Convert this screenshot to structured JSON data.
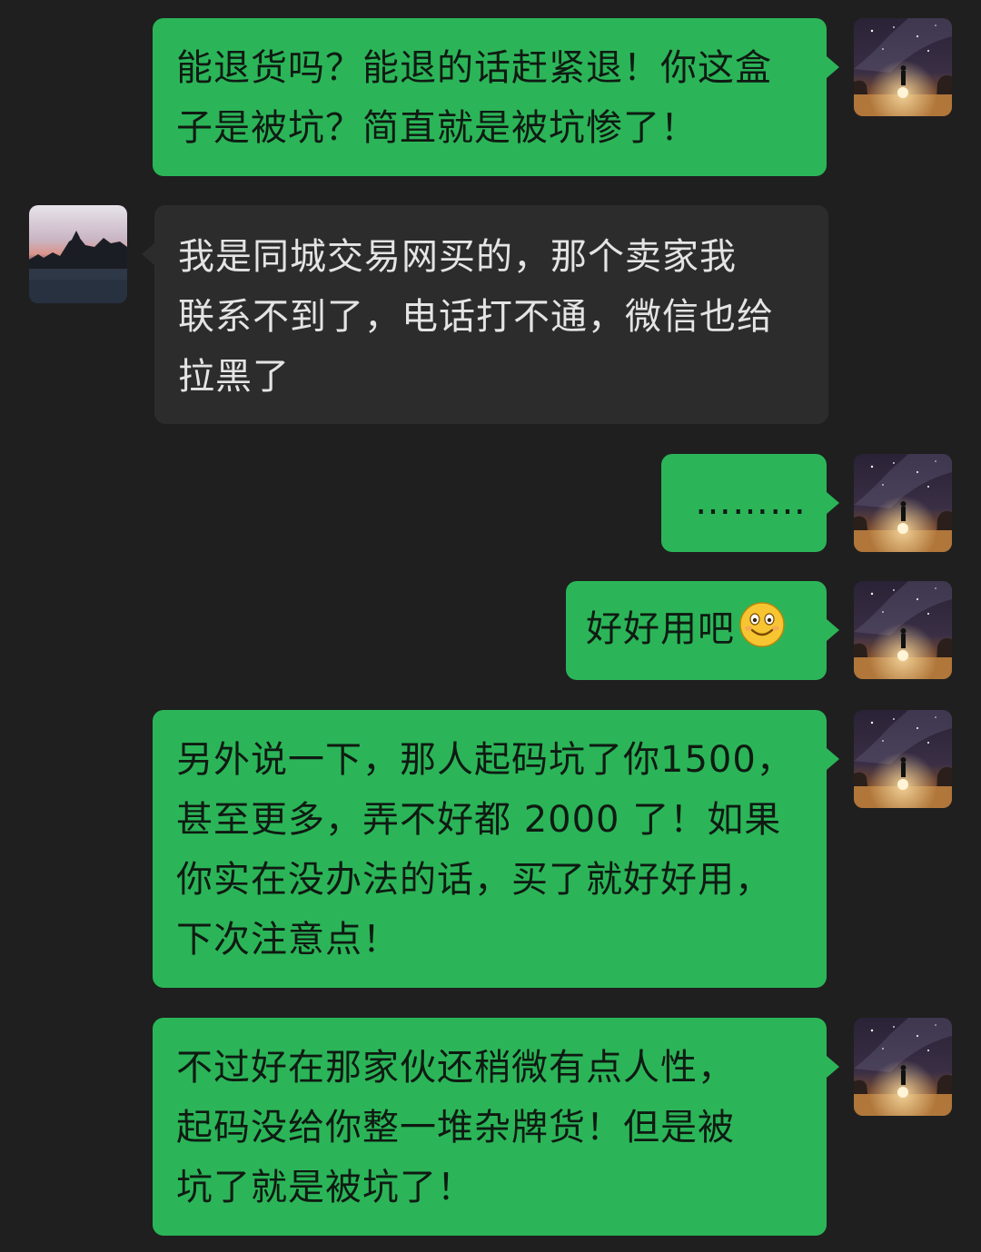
{
  "conversation": {
    "messages": [
      {
        "side": "out",
        "lines": [
          "能退货吗？能退的话赶紧退！你这盒",
          "子是被坑？简直就是被坑惨了！"
        ]
      },
      {
        "side": "in",
        "lines": [
          "我是同城交易网买的，那个卖家我",
          "联系不到了，电话打不通，微信也给",
          "拉黑了"
        ]
      },
      {
        "side": "out",
        "lines": [
          "………"
        ]
      },
      {
        "side": "out",
        "lines": [
          "好好用吧"
        ],
        "emoji": "smile-emoji"
      },
      {
        "side": "out",
        "lines": [
          "另外说一下，那人起码坑了你1500，",
          "甚至更多，弄不好都 2000 了！如果",
          "你实在没办法的话，买了就好好用，",
          "下次注意点！"
        ]
      },
      {
        "side": "out",
        "lines": [
          "不过好在那家伙还稍微有点人性，",
          "起码没给你整一堆杂牌货！但是被",
          "坑了就是被坑了！"
        ]
      }
    ]
  },
  "colors": {
    "background": "#1f1f1f",
    "outgoing_bubble": "#2bb558",
    "incoming_bubble": "#2c2c2c"
  },
  "icons": {
    "self_avatar": "night-sky-person-avatar",
    "contact_avatar": "sunset-landscape-avatar"
  }
}
